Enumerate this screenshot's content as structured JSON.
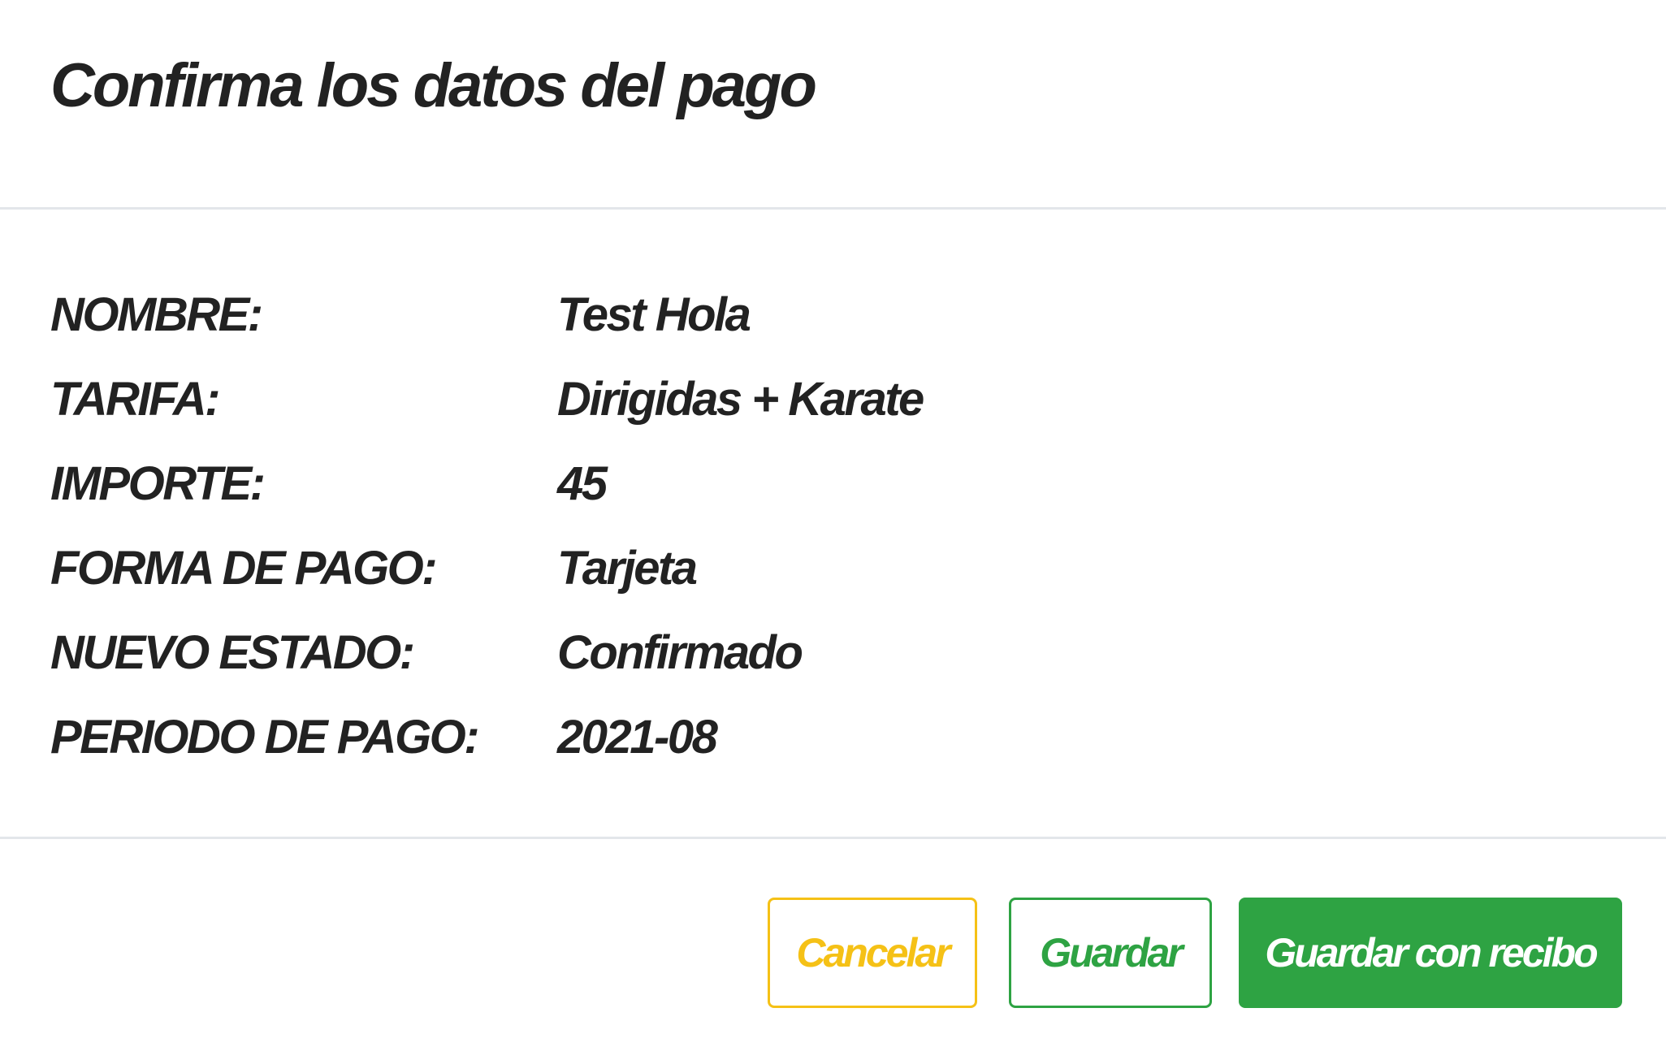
{
  "dialog": {
    "title": "Confirma los datos del pago"
  },
  "details": [
    {
      "label": "NOMBRE:",
      "value": "Test Hola"
    },
    {
      "label": "TARIFA:",
      "value": "Dirigidas + Karate"
    },
    {
      "label": "IMPORTE:",
      "value": "45"
    },
    {
      "label": "FORMA DE PAGO:",
      "value": "Tarjeta"
    },
    {
      "label": "NUEVO ESTADO:",
      "value": "Confirmado"
    },
    {
      "label": "PERIODO DE PAGO:",
      "value": "2021-08"
    }
  ],
  "footer": {
    "cancel_label": "Cancelar",
    "save_label": "Guardar",
    "save_receipt_label": "Guardar con recibo"
  },
  "colors": {
    "cancel": "#f5c116",
    "save": "#2ea343",
    "divider": "#e3e6ea"
  }
}
